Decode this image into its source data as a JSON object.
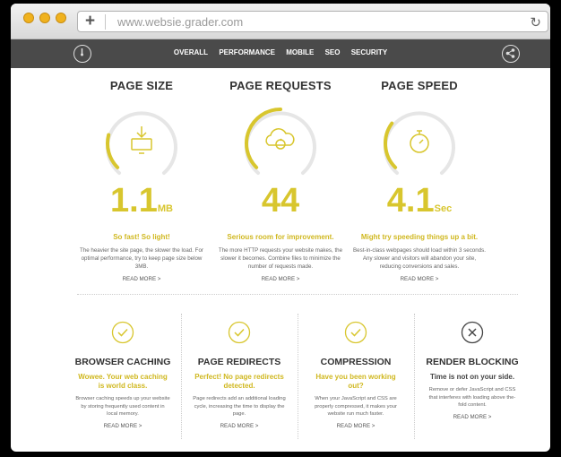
{
  "browser": {
    "new_tab": "+",
    "url": "www.websie.grader.com",
    "reload": "↻"
  },
  "nav": {
    "items": [
      "OVERALL",
      "PERFORMANCE",
      "MOBILE",
      "SEO",
      "SECURITY"
    ]
  },
  "metrics": [
    {
      "title": "PAGE SIZE",
      "value": "1.1",
      "unit": "MB",
      "status": "So fast! So light!",
      "desc": "The heavier the site page, the slower the load. For optimal performance, try to keep page size below 3MB.",
      "more": "READ MORE >",
      "gauge_fraction": 0.22,
      "icon": "download-monitor-icon"
    },
    {
      "title": "PAGE REQUESTS",
      "value": "44",
      "unit": "",
      "status": "Serious room for improvement.",
      "desc": "The more HTTP requests your website makes, the slower it becomes. Combine files to minimize the number of requests made.",
      "more": "READ MORE >",
      "gauge_fraction": 0.5,
      "icon": "cloud-sync-icon"
    },
    {
      "title": "PAGE SPEED",
      "value": "4.1",
      "unit": "Sec",
      "status": "Might try speeding things up a bit.",
      "desc": "Best-in-class webpages should load within 3 seconds. Any slower and visitors will abandon your site, reducing conversions and sales.",
      "more": "READ MORE >",
      "gauge_fraction": 0.3,
      "icon": "stopwatch-icon"
    }
  ],
  "checks": [
    {
      "title": "BROWSER CACHING",
      "status": "Wowee. Your web caching is world class.",
      "desc": "Browser caching speeds up your website by storing frequently used content in local memory.",
      "more": "READ MORE >",
      "passed": true
    },
    {
      "title": "PAGE REDIRECTS",
      "status": "Perfect! No page redirects detected.",
      "desc": "Page redirects add an additional loading cycle, increasing the time to display the page.",
      "more": "READ MORE >",
      "passed": true
    },
    {
      "title": "COMPRESSION",
      "status": "Have you been working out?",
      "desc": "When your JavaScript and CSS are properly compressed, it makes your website run much faster.",
      "more": "READ MORE >",
      "passed": true
    },
    {
      "title": "RENDER BLOCKING",
      "status": "Time is not on your side.",
      "desc": "Remove or defer JavaScript and CSS that interferes with loading above the-fold content.",
      "more": "READ MORE >",
      "passed": false
    }
  ],
  "colors": {
    "accent": "#d8c62e",
    "track": "#e6e6e6",
    "nav": "#4a4a4a",
    "fail": "#444444"
  }
}
